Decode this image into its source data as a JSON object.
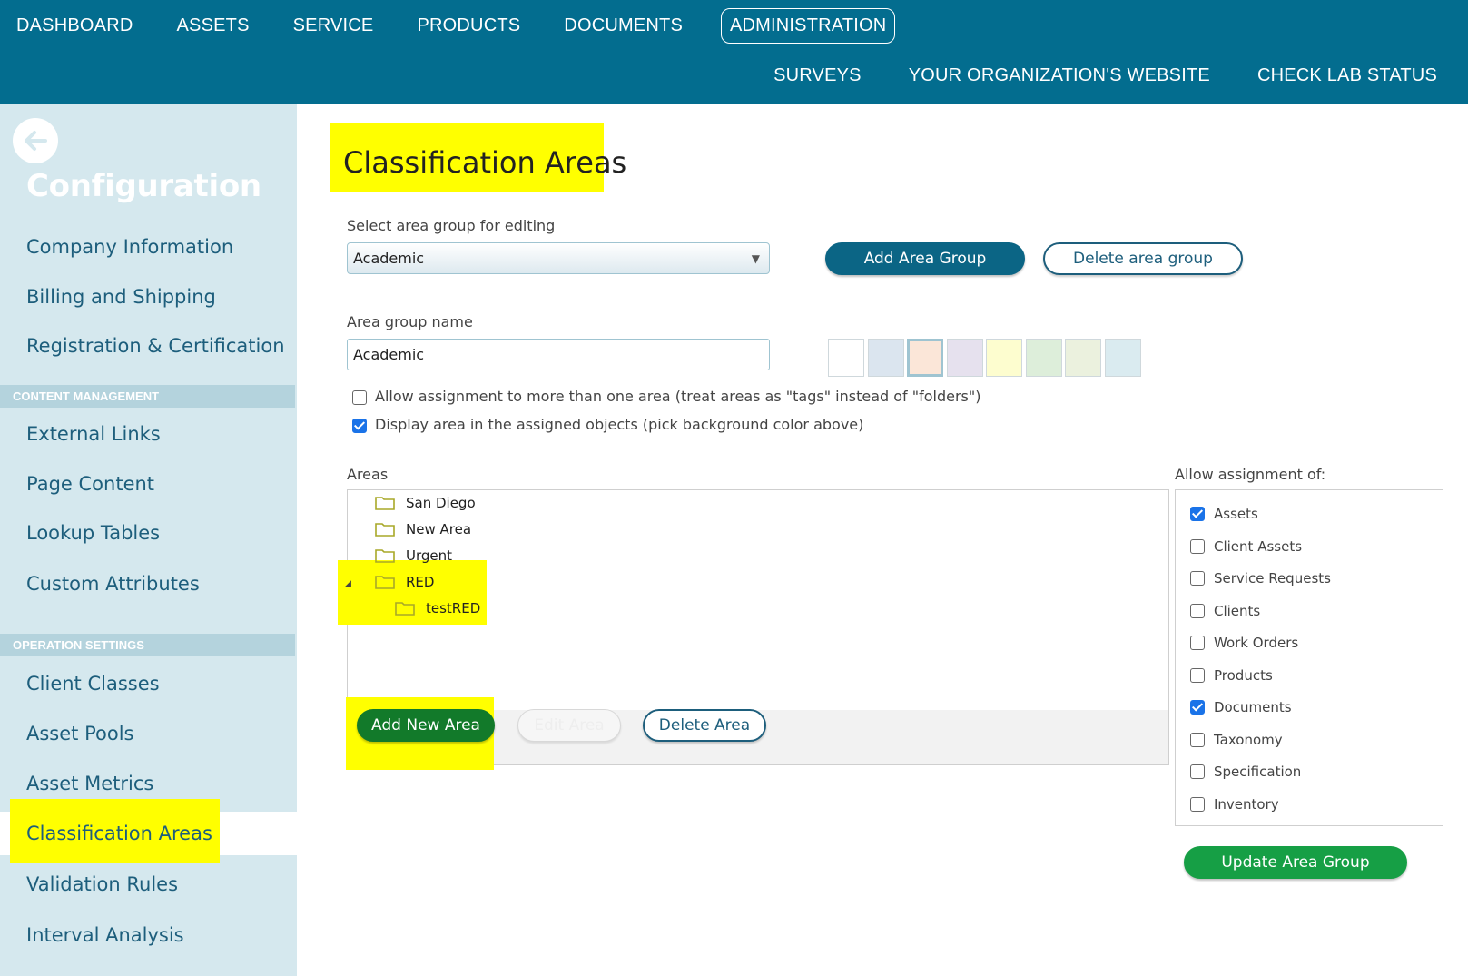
{
  "nav": {
    "main": [
      "DASHBOARD",
      "ASSETS",
      "SERVICE",
      "PRODUCTS",
      "DOCUMENTS",
      "ADMINISTRATION"
    ],
    "sub": [
      "SURVEYS",
      "YOUR ORGANIZATION'S WEBSITE",
      "CHECK LAB STATUS"
    ]
  },
  "sidebar": {
    "title": "Configuration",
    "items_top": [
      "Company Information",
      "Billing and Shipping",
      "Registration & Certification"
    ],
    "section_content": "CONTENT MANAGEMENT",
    "items_content": [
      "External Links",
      "Page Content",
      "Lookup Tables",
      "Custom Attributes"
    ],
    "section_operation": "OPERATION SETTINGS",
    "items_operation": [
      "Client Classes",
      "Asset Pools",
      "Asset Metrics",
      "Classification Areas",
      "Validation Rules",
      "Interval Analysis"
    ],
    "selected": "Classification Areas"
  },
  "page": {
    "title": "Classification Areas",
    "select_label": "Select area group for editing",
    "select_value": "Academic",
    "add_group_btn": "Add Area Group",
    "delete_group_btn": "Delete area group",
    "group_name_label": "Area group name",
    "group_name_value": "Academic",
    "swatch_colors": [
      "#ffffff",
      "#dbe5ef",
      "#fbe6d8",
      "#e6e1ee",
      "#fdfdcf",
      "#ddeeda",
      "#ebf1de",
      "#daebf0"
    ],
    "selected_swatch": 2,
    "opt_multi": "Allow assignment to more than one area (treat areas as \"tags\" instead of \"folders\")",
    "opt_multi_checked": false,
    "opt_display": "Display area in the assigned objects (pick background color above)",
    "opt_display_checked": true,
    "areas_label": "Areas",
    "areas": [
      "San Diego",
      "New Area",
      "Urgent",
      "RED",
      "testRED"
    ],
    "add_area_btn": "Add New Area",
    "edit_area_btn": "Edit Area",
    "delete_area_btn": "Delete Area",
    "allow_label": "Allow assignment of:",
    "allow": [
      {
        "label": "Assets",
        "checked": true
      },
      {
        "label": "Client Assets",
        "checked": false
      },
      {
        "label": "Service Requests",
        "checked": false
      },
      {
        "label": "Clients",
        "checked": false
      },
      {
        "label": "Work Orders",
        "checked": false
      },
      {
        "label": "Products",
        "checked": false
      },
      {
        "label": "Documents",
        "checked": true
      },
      {
        "label": "Taxonomy",
        "checked": false
      },
      {
        "label": "Specification",
        "checked": false
      },
      {
        "label": "Inventory",
        "checked": false
      }
    ],
    "update_btn": "Update Area Group"
  },
  "colors": {
    "topbar": "#036d8f",
    "sidebar": "#d5e8ee",
    "highlight": "#ffff00",
    "primary": "#0b6585",
    "green": "#169f45"
  }
}
